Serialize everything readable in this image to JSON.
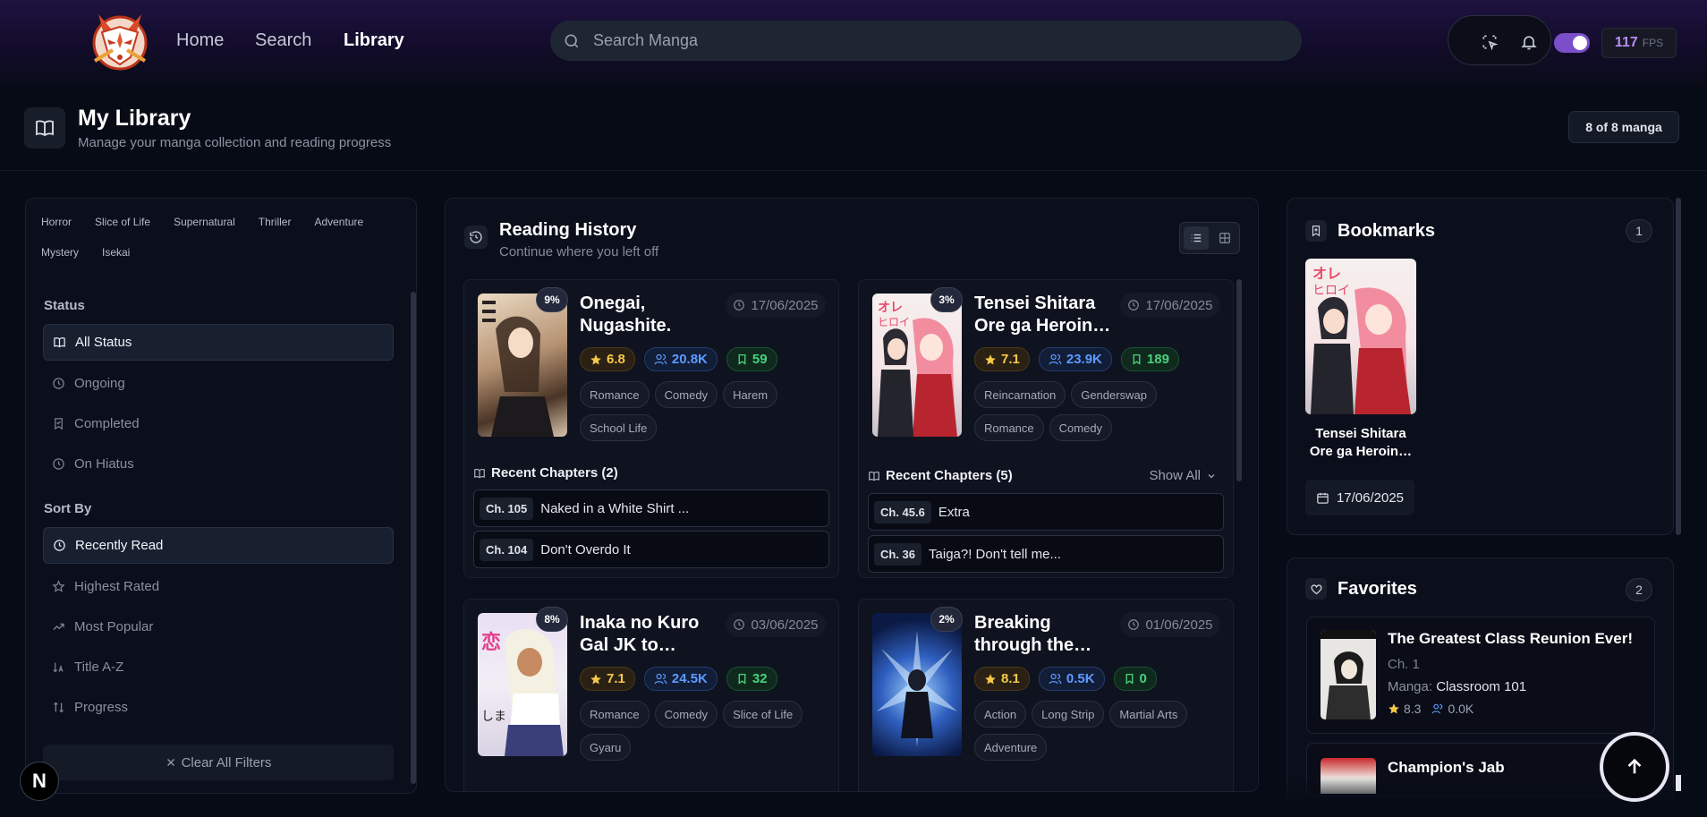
{
  "nav": {
    "items": [
      {
        "label": "Home",
        "active": false
      },
      {
        "label": "Search",
        "active": false
      },
      {
        "label": "Library",
        "active": true
      }
    ],
    "search_placeholder": "Search Manga",
    "fps_value": "117",
    "fps_label": "FPS"
  },
  "header": {
    "title": "My Library",
    "subtitle": "Manage your manga collection and reading progress",
    "count": "8 of 8 manga"
  },
  "filters": {
    "genres": [
      "Horror",
      "Slice of Life",
      "Supernatural",
      "Thriller",
      "Adventure",
      "Mystery",
      "Isekai"
    ],
    "status_heading": "Status",
    "status": [
      "All Status",
      "Ongoing",
      "Completed",
      "On Hiatus"
    ],
    "sort_heading": "Sort By",
    "sort": [
      "Recently Read",
      "Highest Rated",
      "Most Popular",
      "Title A-Z",
      "Progress"
    ],
    "clear": "Clear All Filters"
  },
  "history": {
    "title": "Reading History",
    "subtitle": "Continue where you left off",
    "recent_prefix": "Recent Chapters",
    "show_all": "Show All",
    "cards": [
      {
        "title": "Onegai, Nugashite.",
        "progress": "9%",
        "date": "17/06/2025",
        "rating": "6.8",
        "views": "20.8K",
        "bookmarks": "59",
        "tags": [
          "Romance",
          "Comedy",
          "Harem",
          "School Life"
        ],
        "recent_label": "Recent Chapters (2)",
        "chapters": [
          {
            "num": "Ch. 105",
            "title": "Naked in a White Shirt ..."
          },
          {
            "num": "Ch. 104",
            "title": "Don't Overdo It"
          }
        ]
      },
      {
        "title": "Tensei Shitara Ore ga Heroin…",
        "progress": "3%",
        "date": "17/06/2025",
        "rating": "7.1",
        "views": "23.9K",
        "bookmarks": "189",
        "tags": [
          "Reincarnation",
          "Genderswap",
          "Romance",
          "Comedy"
        ],
        "recent_label": "Recent Chapters (5)",
        "chapters": [
          {
            "num": "Ch. 45.6",
            "title": "Extra"
          },
          {
            "num": "Ch. 36",
            "title": "Taiga?! Don't tell me..."
          }
        ]
      },
      {
        "title": "Inaka no Kuro Gal JK to…",
        "progress": "8%",
        "date": "03/06/2025",
        "rating": "7.1",
        "views": "24.5K",
        "bookmarks": "32",
        "tags": [
          "Romance",
          "Comedy",
          "Slice of Life",
          "Gyaru"
        ]
      },
      {
        "title": "Breaking through the…",
        "progress": "2%",
        "date": "01/06/2025",
        "rating": "8.1",
        "views": "0.5K",
        "bookmarks": "0",
        "tags": [
          "Action",
          "Long Strip",
          "Martial Arts",
          "Adventure"
        ]
      }
    ]
  },
  "bookmarks": {
    "title": "Bookmarks",
    "count": "1",
    "item_title": "Tensei Shitara Ore ga Heroin…",
    "item_date": "17/06/2025"
  },
  "favorites": {
    "title": "Favorites",
    "count": "2",
    "items": [
      {
        "title": "The Greatest Class Reunion Ever!",
        "chapter": "Ch. 1",
        "manga_label": "Manga:",
        "manga": "Classroom 101",
        "rating": "8.3",
        "views": "0.0K"
      },
      {
        "title": "Champion's Jab"
      }
    ]
  },
  "misc": {
    "next_badge": "N"
  },
  "colors": {
    "accent": "#7a4fc9",
    "rating": "#f6c84a",
    "views": "#5c9bff",
    "bookmarks": "#4ad17e",
    "background": "#070b16"
  }
}
